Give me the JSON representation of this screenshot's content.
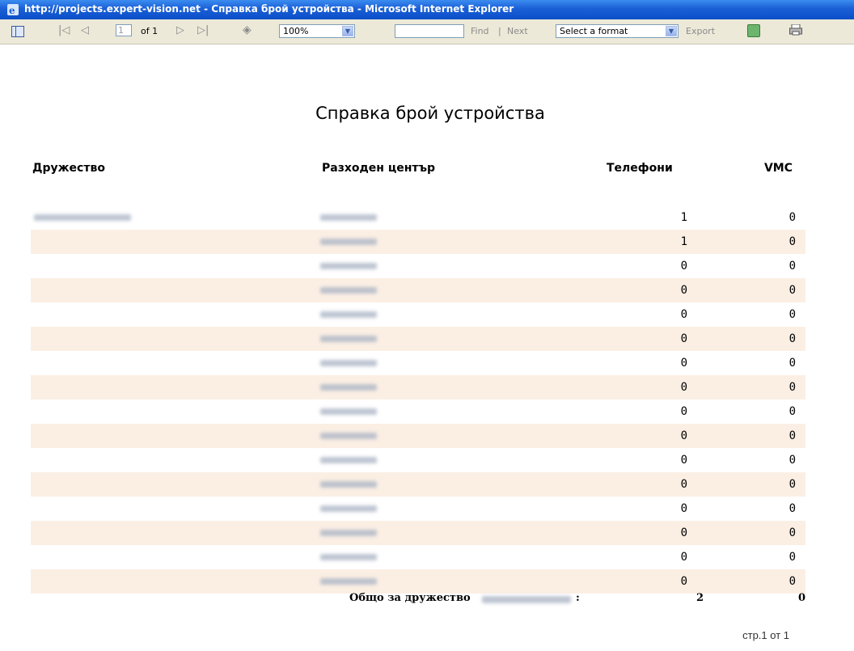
{
  "window": {
    "title": "http://projects.expert-vision.net - Справка брой устройства - Microsoft Internet Explorer"
  },
  "toolbar": {
    "page_current": "1",
    "page_of": "of 1",
    "zoom_value": "100%",
    "find_value": "",
    "find_label": "Find",
    "separator": "|",
    "next_label": "Next",
    "format_value": "Select a format",
    "export_label": "Export",
    "icons": {
      "doc_map": "document-map-icon",
      "first": "first-page-icon",
      "prev": "previous-page-icon",
      "next": "next-page-icon",
      "last": "last-page-icon",
      "back": "back-to-parent-icon",
      "refresh": "refresh-icon",
      "print": "print-icon"
    }
  },
  "report": {
    "title": "Справка брой устройства",
    "columns": {
      "company": "Дружество",
      "cost_center": "Разходен център",
      "phones": "Телефони",
      "vmc": "VMC"
    },
    "rows": [
      {
        "phones": "1",
        "vmc": "0"
      },
      {
        "phones": "1",
        "vmc": "0"
      },
      {
        "phones": "0",
        "vmc": "0"
      },
      {
        "phones": "0",
        "vmc": "0"
      },
      {
        "phones": "0",
        "vmc": "0"
      },
      {
        "phones": "0",
        "vmc": "0"
      },
      {
        "phones": "0",
        "vmc": "0"
      },
      {
        "phones": "0",
        "vmc": "0"
      },
      {
        "phones": "0",
        "vmc": "0"
      },
      {
        "phones": "0",
        "vmc": "0"
      },
      {
        "phones": "0",
        "vmc": "0"
      },
      {
        "phones": "0",
        "vmc": "0"
      },
      {
        "phones": "0",
        "vmc": "0"
      },
      {
        "phones": "0",
        "vmc": "0"
      },
      {
        "phones": "0",
        "vmc": "0"
      },
      {
        "phones": "0",
        "vmc": "0"
      }
    ],
    "total": {
      "label": "Общо за дружество",
      "colon": ":",
      "phones": "2",
      "vmc": "0"
    },
    "page_footer": "стр.1 от 1"
  },
  "colors": {
    "titlebar": "#0b4fc8",
    "toolbar": "#ece9d8",
    "alt_row": "#fbefe4"
  }
}
